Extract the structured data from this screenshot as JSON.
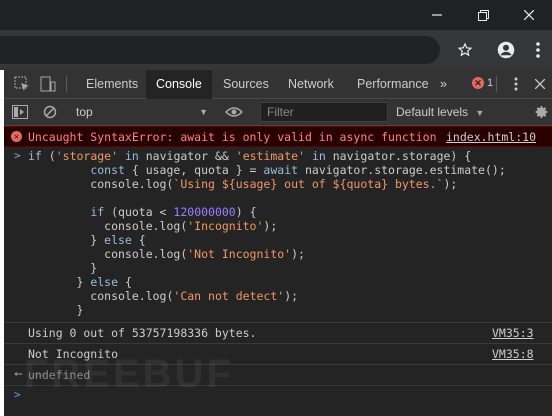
{
  "window": {
    "minimize_icon": "minimize-icon",
    "restore_icon": "restore-icon",
    "close_icon": "close-icon"
  },
  "addressbar": {
    "star_icon": "star-icon",
    "account_icon": "account-icon",
    "menu_icon": "more-vert-icon"
  },
  "devtools": {
    "tabs": [
      "Elements",
      "Console",
      "Sources",
      "Network",
      "Performance"
    ],
    "active_tab": "Console",
    "more_tabs": "»",
    "error_count": "1",
    "context": "top",
    "filter_placeholder": "Filter",
    "levels": "Default levels"
  },
  "console": {
    "error_message": "Uncaught SyntaxError: await is only valid in async function",
    "error_source": "index.html:10",
    "log1_text": "Using 0 out of 53757198336 bytes.",
    "log1_source": "VM35:3",
    "log2_text": "Not Incognito",
    "log2_source": "VM35:8",
    "return_value": "undefined"
  },
  "watermark": "FREEBUF",
  "colors": {
    "background": "#242424",
    "error_text": "#ff8080",
    "string": "#f29766",
    "keyword": "#9bbbdc",
    "number": "#9980ff"
  }
}
